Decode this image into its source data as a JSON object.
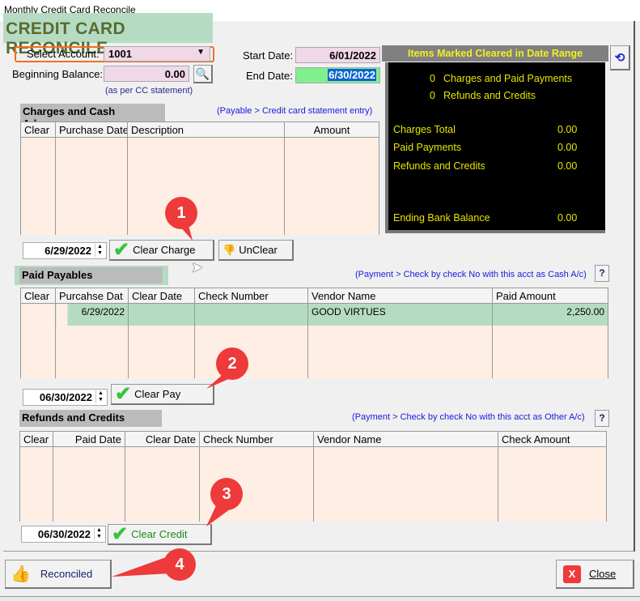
{
  "window_title": "Monthly Credit Card Reconcile",
  "banner": "CREDIT CARD RECONCILE",
  "account": {
    "label": "Select Account:",
    "value": "1001"
  },
  "beginning_balance": {
    "label": "Beginning Balance:",
    "value": "0.00",
    "note": "(as per CC statement)"
  },
  "start_date": {
    "label": "Start Date:",
    "value": "6/01/2022"
  },
  "end_date": {
    "label": "End Date:",
    "value": "6/30/2022"
  },
  "summary": {
    "title": "Items Marked Cleared in Date Range",
    "charges_count": "0",
    "charges_label": "Charges and Paid Payments",
    "refunds_count": "0",
    "refunds_label": "Refunds and Credits",
    "rows": [
      {
        "label": "Charges Total",
        "value": "0.00"
      },
      {
        "label": "Paid Payments",
        "value": "0.00"
      },
      {
        "label": "Refunds and Credits",
        "value": "0.00"
      },
      {
        "label": "Ending Bank Balance",
        "value": "0.00"
      }
    ]
  },
  "charges": {
    "title": "Charges and Cash Advances",
    "hint": "(Payable > Credit card statement entry)",
    "columns": [
      "Clear",
      "Purchase Date",
      "Description",
      "Amount"
    ],
    "date": "6/29/2022",
    "clear_label": "Clear Charge",
    "unclear_label": "UnClear"
  },
  "payables": {
    "title": "Paid Payables",
    "hint": "(Payment > Check by check No with this acct as Cash A/c)",
    "columns": [
      "Clear",
      "Purcahse Dat",
      "Clear Date",
      "Check Number",
      "Vendor Name",
      "Paid Amount"
    ],
    "rows": [
      {
        "clear": "",
        "purchase_date": "6/29/2022",
        "clear_date": "",
        "check_number": "",
        "vendor": "GOOD VIRTUES",
        "amount": "2,250.00"
      }
    ],
    "date": "06/30/2022",
    "clear_label": "Clear Pay"
  },
  "refunds": {
    "title": "Refunds and Credits",
    "hint": "(Payment > Check by check No with this acct as Other A/c)",
    "columns": [
      "Clear",
      "Paid Date",
      "Clear Date",
      "Check Number",
      "Vendor Name",
      "Check Amount"
    ],
    "date": "06/30/2022",
    "clear_label": "Clear Credit"
  },
  "help_label": "?",
  "reconciled_label": "Reconciled",
  "close_label": "Close",
  "callouts": [
    "1",
    "2",
    "3",
    "4"
  ],
  "colors": {
    "accent_orange": "#f07020",
    "callout": "#ee3a3a",
    "row_highlight": "#b5dcc3",
    "grid_bg": "#feeee4",
    "summary_text": "#e6e600"
  }
}
